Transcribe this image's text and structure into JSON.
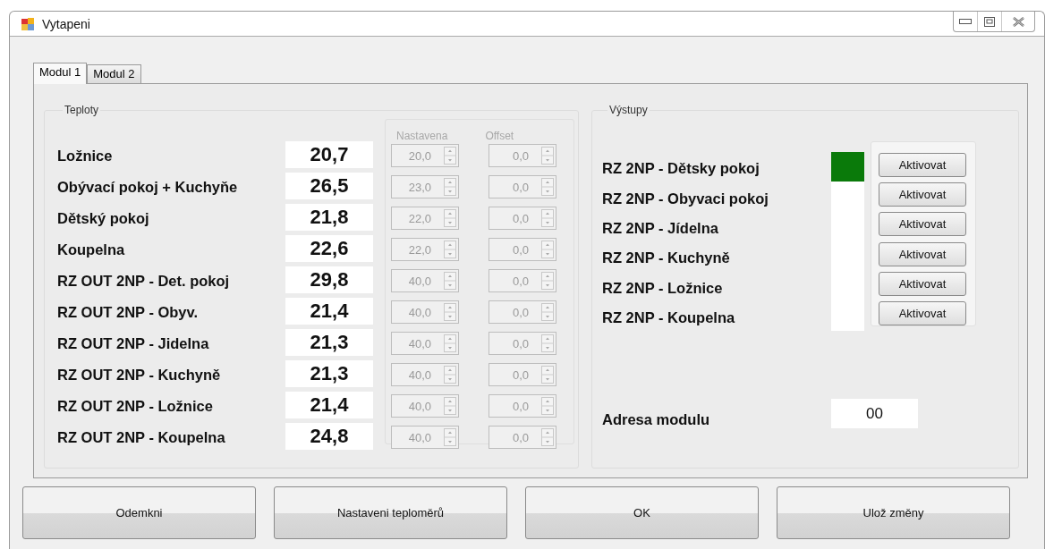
{
  "window": {
    "title": "Vytapeni"
  },
  "tabs": [
    {
      "label": "Modul 1",
      "selected": true
    },
    {
      "label": "Modul 2",
      "selected": false
    }
  ],
  "teploty": {
    "title": "Teploty",
    "setpoint_header": "Nastavena",
    "offset_header": "Offset",
    "spinners_disabled": true,
    "rows": [
      {
        "name": "Ložnice",
        "value": "20,7",
        "setpoint": "20,0",
        "correction": "0,0"
      },
      {
        "name": "Obývací pokoj + Kuchyňe",
        "value": "26,5",
        "setpoint": "23,0",
        "correction": "0,0"
      },
      {
        "name": "Dětský pokoj",
        "value": "21,8",
        "setpoint": "22,0",
        "correction": "0,0"
      },
      {
        "name": "Koupelna",
        "value": "22,6",
        "setpoint": "22,0",
        "correction": "0,0"
      },
      {
        "name": "RZ OUT 2NP - Det. pokoj",
        "value": "29,8",
        "setpoint": "40,0",
        "correction": "0,0"
      },
      {
        "name": "RZ OUT 2NP - Obyv.",
        "value": "21,4",
        "setpoint": "40,0",
        "correction": "0,0"
      },
      {
        "name": "RZ OUT 2NP - Jidelna",
        "value": "21,3",
        "setpoint": "40,0",
        "correction": "0,0"
      },
      {
        "name": "RZ OUT 2NP - Kuchyně",
        "value": "21,3",
        "setpoint": "40,0",
        "correction": "0,0"
      },
      {
        "name": "RZ OUT 2NP - Ložnice",
        "value": "21,4",
        "setpoint": "40,0",
        "correction": "0,0"
      },
      {
        "name": "RZ OUT 2NP - Koupelna",
        "value": "24,8",
        "setpoint": "40,0",
        "correction": "0,0"
      }
    ]
  },
  "vystupy": {
    "title": "Výstupy",
    "outputs": [
      {
        "name": "RZ 2NP - Dětsky pokoj",
        "on": true,
        "button": "Aktivovat"
      },
      {
        "name": "RZ 2NP - Obyvaci pokoj",
        "on": false,
        "button": "Aktivovat"
      },
      {
        "name": "RZ 2NP - Jídelna",
        "on": false,
        "button": "Aktivovat"
      },
      {
        "name": "RZ 2NP - Kuchyně",
        "on": false,
        "button": "Aktivovat"
      },
      {
        "name": "RZ 2NP - Ložnice",
        "on": false,
        "button": "Aktivovat"
      },
      {
        "name": "RZ 2NP - Koupelna",
        "on": false,
        "button": "Aktivovat"
      }
    ],
    "address_label": "Adresa modulu",
    "address_value": "00"
  },
  "buttons": [
    "Odemkni",
    "Nastaveni teploměrů",
    "OK",
    "Ulož změny"
  ]
}
